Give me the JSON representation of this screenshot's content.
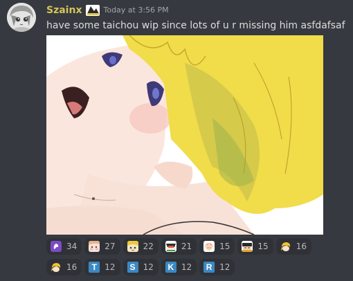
{
  "message": {
    "author": "Szainx",
    "timestamp": "Today at 3:56 PM",
    "content": "have some taichou wip since lots of u r missing him asfdafsaf",
    "attachment_alt": "taichou wip"
  },
  "reactions": [
    {
      "icon": "purple-sparkle-emoji",
      "count": "34"
    },
    {
      "icon": "pink-face-emoji",
      "count": "27"
    },
    {
      "icon": "blonde-chibi-emoji",
      "count": "22"
    },
    {
      "icon": "sushi-chibi-emoji",
      "count": "21"
    },
    {
      "icon": "clap-chibi-emoji",
      "count": "15"
    },
    {
      "icon": "sleepy-chibi-emoji",
      "count": "15"
    },
    {
      "icon": "yellow-hair-emoji",
      "count": "16"
    },
    {
      "icon": "yellow-hair-emoji-2",
      "count": "16"
    },
    {
      "letter": "T",
      "count": "12"
    },
    {
      "letter": "S",
      "count": "12"
    },
    {
      "letter": "K",
      "count": "12"
    },
    {
      "letter": "R",
      "count": "12"
    }
  ],
  "colors": {
    "background": "#36393f",
    "username": "#d6c45a",
    "reaction_bg": "#2f3136",
    "letter_tile": "#3b88c3"
  }
}
